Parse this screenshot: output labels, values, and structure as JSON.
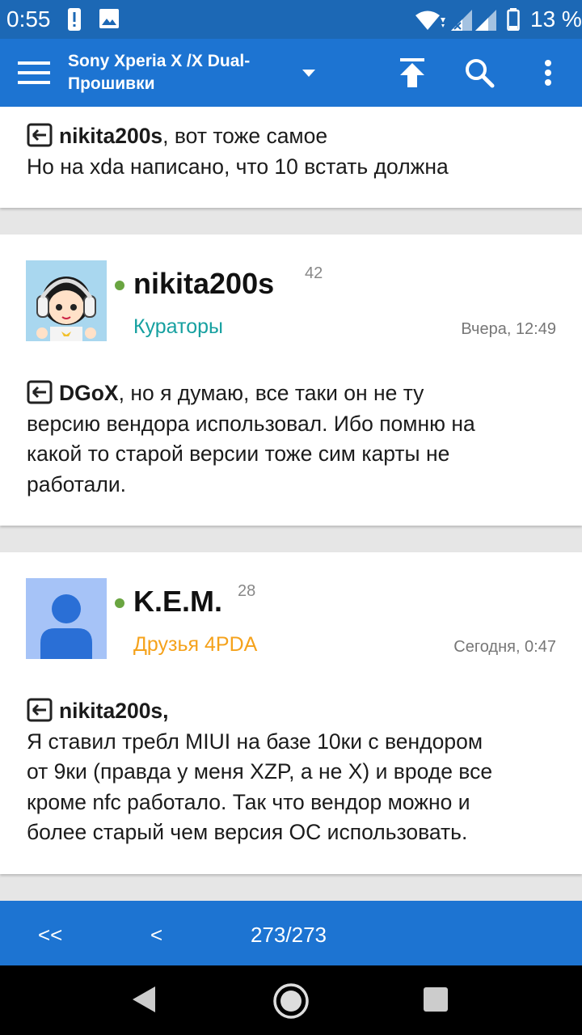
{
  "status_bar": {
    "time": "0:55",
    "battery": "13 %",
    "icons": [
      "alert-icon",
      "image-icon",
      "wifi-icon",
      "signal-icon",
      "signal-icon",
      "battery-icon"
    ]
  },
  "toolbar": {
    "title_line1": "Sony Xperia X /X Dual-",
    "title_line2": "Прошивки",
    "icons": [
      "menu-icon",
      "dropdown-arrow-icon",
      "scroll-top-icon",
      "search-icon",
      "more-icon"
    ]
  },
  "posts": [
    {
      "reply_to": "nikita200s",
      "text_line1_rest": ", вот тоже самое",
      "text_lines": [
        "Но на xda написано, что 10 встать должна"
      ]
    },
    {
      "username": "nikita200s",
      "reputation": "42",
      "group": "Кураторы",
      "date": "Вчера, 12:49",
      "reply_to": "DGoX",
      "text_line1_rest": ", но я думаю, все таки он не ту",
      "text_lines": [
        "версию вендора использовал. Ибо помню на",
        "какой то старой версии тоже сим карты не",
        "работали."
      ]
    },
    {
      "username": "K.E.M.",
      "reputation": "28",
      "group": "Друзья 4PDA",
      "date": "Сегодня, 0:47",
      "reply_to": "nikita200s,",
      "text_line1_rest": "",
      "text_lines": [
        "Я ставил требл MIUI на базе 10ки с вендором",
        "от 9ки (правда у меня XZP, а не X) и вроде все",
        "кроме nfc работало. Так что вендор можно и",
        "более старый чем версия ОС использовать."
      ]
    }
  ],
  "pagination": {
    "first": "<<",
    "prev": "<",
    "page": "273/273"
  },
  "colors": {
    "status_bar": "#1c68b5",
    "toolbar": "#1d74d2",
    "curator_group": "#16a0a0",
    "friends_group": "#f5a21b",
    "online": "#6aa541"
  }
}
